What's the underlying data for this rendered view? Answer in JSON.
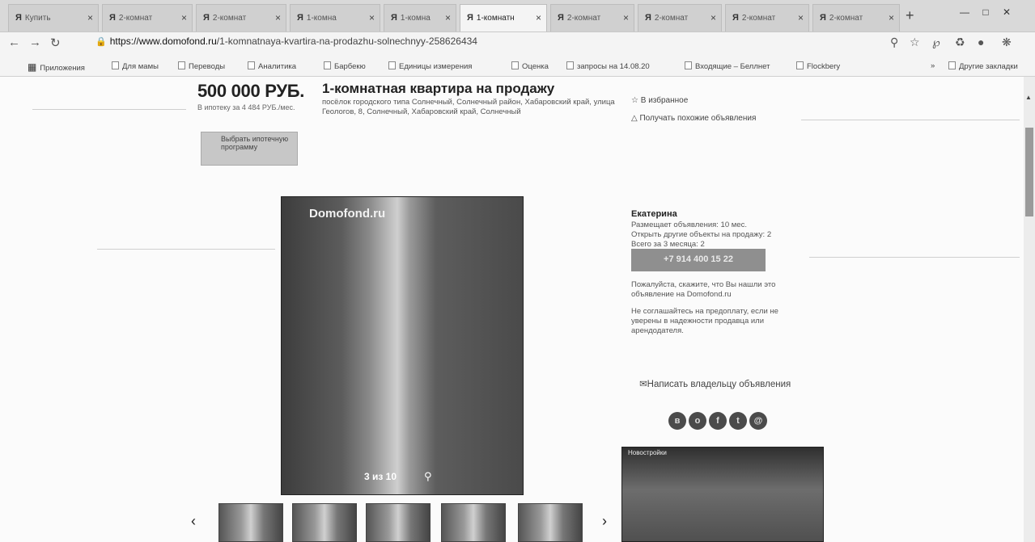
{
  "browser": {
    "tabs": [
      {
        "label": "Купить"
      },
      {
        "label": "2-комнат"
      },
      {
        "label": "2-комнат"
      },
      {
        "label": "1-комна"
      },
      {
        "label": "1-комна"
      },
      {
        "label": "1-комнатн",
        "active": true
      },
      {
        "label": "2-комнат"
      },
      {
        "label": "2-комнат"
      },
      {
        "label": "2-комнат"
      },
      {
        "label": "2-комнат"
      }
    ],
    "tab_close": "×",
    "new_tab": "+",
    "url_host": "https://www.domofond.ru",
    "url_path": "/1-komnatnaya-kvartira-na-prodazhu-solnechnyy-258626434",
    "bookmarks": [
      {
        "label": "Приложения",
        "apps": true
      },
      {
        "label": "Для мамы"
      },
      {
        "label": "Переводы"
      },
      {
        "label": "Аналитика"
      },
      {
        "label": "Барбекю"
      },
      {
        "label": "Единицы измерения"
      },
      {
        "label": "Оценка"
      },
      {
        "label": "запросы на 14.08.20"
      },
      {
        "label": "Входящие – Беллнет"
      },
      {
        "label": "Flockbery"
      },
      {
        "label": "Другие закладки"
      }
    ],
    "bookmarks_more": "»"
  },
  "listing": {
    "price": "500 000 РУБ.",
    "mortgage_text": "В ипотеку за 4 484 РУБ./мес.",
    "mortgage_button": "Выбрать ипотечную программу",
    "title": "1-комнатная квартира на продажу",
    "address": "посёлок городского типа Солнечный, Солнечный район, Хабаровский край, улица Геологов, 8, Солнечный, Хабаровский край, Солнечный",
    "watermark": "Domofond.ru",
    "photo_counter": "3 из 10",
    "prev_arrow": "‹",
    "next_arrow": "›"
  },
  "sidebar": {
    "favorite_link": "В избранное",
    "similar_link": "Получать похожие объявления",
    "seller_name": "Екатерина",
    "seller_since": "Размещает объявления: 10 мес.",
    "seller_other": "Открыть другие объекты на продажу: 2",
    "seller_quarter": "Всего за 3 месяца: 2",
    "phone_button": "+7 914 400 15 22",
    "note_mention": "Пожалуйста, скажите, что Вы нашли это объявление на Domofond.ru",
    "note_warning": "Не соглашайтесь на предоплату, если не уверены в надежности продавца или арендодателя.",
    "write_owner": "Написать владельцу объявления",
    "social_icons": [
      "vk",
      "ok",
      "fb",
      "tw",
      "mail"
    ],
    "ad_title": "Новостройки"
  }
}
